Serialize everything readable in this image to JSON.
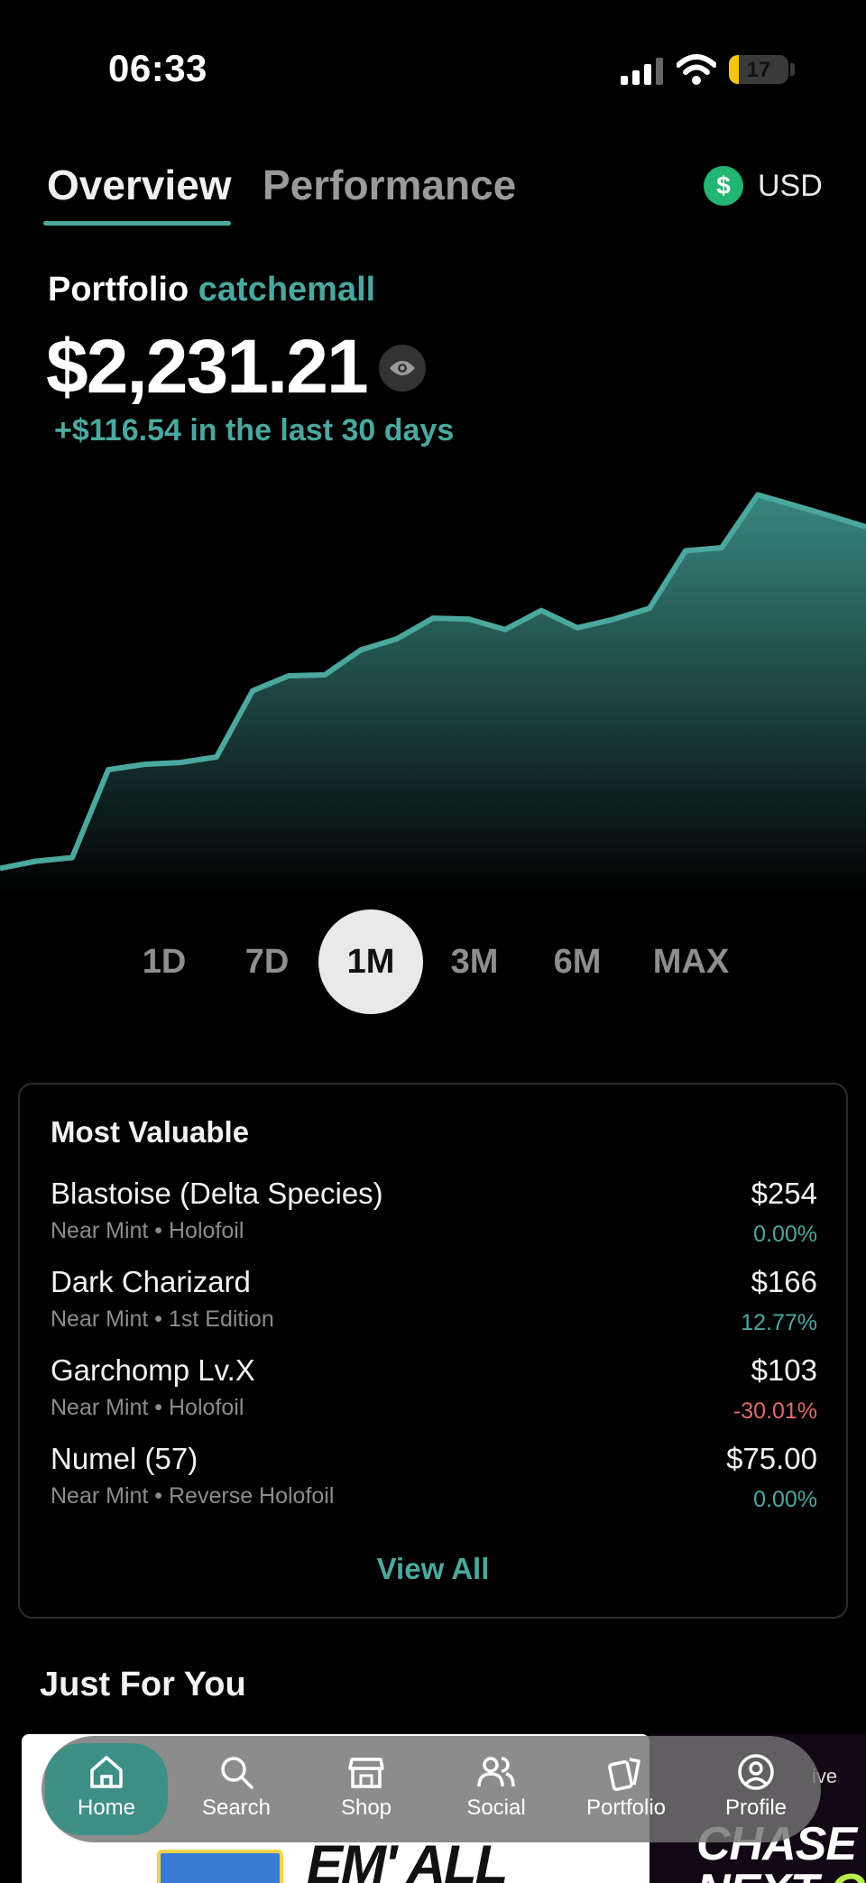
{
  "status_bar": {
    "time": "06:33",
    "battery": "17",
    "battery_level": 0.17
  },
  "tabs": [
    {
      "label": "Overview",
      "active": true
    },
    {
      "label": "Performance",
      "active": false
    }
  ],
  "currency": {
    "symbol": "$",
    "label": "USD"
  },
  "portfolio": {
    "label": "Portfolio",
    "name": "catchemall",
    "value": "$2,231.21",
    "change": "+$116.54 in the last 30 days"
  },
  "colors": {
    "accent": "#4ba89f",
    "negative": "#e06a6a",
    "positive": "#4ba89f",
    "background": "#000000"
  },
  "chart_data": {
    "type": "area",
    "x": [
      1,
      2,
      3,
      4,
      5,
      6,
      7,
      8,
      9,
      10,
      11,
      12,
      13,
      14,
      15,
      16,
      17,
      18,
      19,
      20,
      21,
      22,
      23,
      24,
      25
    ],
    "values": [
      2114.7,
      2118.9,
      2121.0,
      2172.8,
      2176.0,
      2177.1,
      2180.3,
      2219.3,
      2228.2,
      2228.7,
      2243.4,
      2250.0,
      2262.2,
      2261.6,
      2255.5,
      2266.7,
      2256.5,
      2261.5,
      2268.0,
      2301.9,
      2303.7,
      2334.9,
      2328.8,
      2322.5,
      2316.0
    ],
    "ylim": [
      2100,
      2350
    ]
  },
  "ranges": [
    {
      "label": "1D",
      "active": false
    },
    {
      "label": "7D",
      "active": false
    },
    {
      "label": "1M",
      "active": true
    },
    {
      "label": "3M",
      "active": false
    },
    {
      "label": "6M",
      "active": false
    },
    {
      "label": "MAX",
      "active": false
    }
  ],
  "most_valuable": {
    "title": "Most Valuable",
    "items": [
      {
        "name": "Blastoise (Delta Species)",
        "condition": "Near Mint • Holofoil",
        "price": "$254",
        "change": "0.00%",
        "negative": false
      },
      {
        "name": "Dark Charizard",
        "condition": "Near Mint • 1st Edition",
        "price": "$166",
        "change": "12.77%",
        "negative": false
      },
      {
        "name": "Garchomp Lv.X",
        "condition": "Near Mint • Holofoil",
        "price": "$103",
        "change": "-30.01%",
        "negative": true
      },
      {
        "name": "Numel (57)",
        "condition": "Near Mint • Reverse Holofoil",
        "price": "$75.00",
        "change": "0.00%",
        "negative": false
      }
    ],
    "view_all": "View All"
  },
  "just_for_you": {
    "title": "Just For You",
    "banners": [
      {
        "text": "EM' ALL"
      },
      {
        "top_text": "ive",
        "line1": "CHASE YOU",
        "line2_a": "NEXT ",
        "line2_b": "GRAIL"
      }
    ]
  },
  "bottom_nav": [
    {
      "label": "Home",
      "icon": "home-icon",
      "active": true
    },
    {
      "label": "Search",
      "icon": "search-icon",
      "active": false
    },
    {
      "label": "Shop",
      "icon": "shop-icon",
      "active": false
    },
    {
      "label": "Social",
      "icon": "social-icon",
      "active": false
    },
    {
      "label": "Portfolio",
      "icon": "portfolio-icon",
      "active": false
    },
    {
      "label": "Profile",
      "icon": "profile-icon",
      "active": false
    }
  ]
}
